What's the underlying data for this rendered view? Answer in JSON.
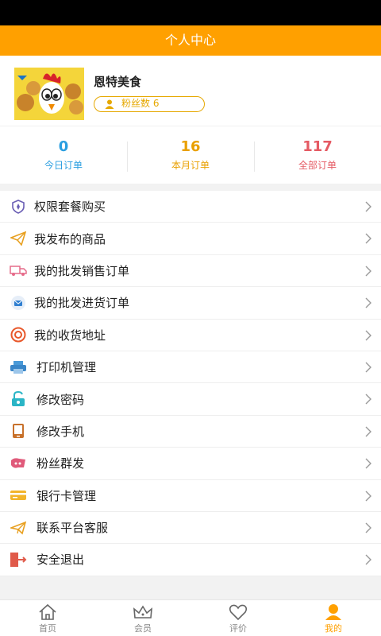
{
  "header": {
    "title": "个人中心"
  },
  "profile": {
    "name": "恩特美食",
    "fans_label": "粉丝数 6"
  },
  "stats": [
    {
      "value": "0",
      "label": "今日订单",
      "color": "#2a9ee0"
    },
    {
      "value": "16",
      "label": "本月订单",
      "color": "#e9a000"
    },
    {
      "value": "117",
      "label": "全部订单",
      "color": "#e55a63"
    }
  ],
  "menu": [
    {
      "label": "权限套餐购买",
      "icon": "shield-icon"
    },
    {
      "label": "我发布的商品",
      "icon": "paper-plane-icon"
    },
    {
      "label": "我的批发销售订单",
      "icon": "truck-icon"
    },
    {
      "label": "我的批发进货订单",
      "icon": "mail-icon"
    },
    {
      "label": "我的收货地址",
      "icon": "target-icon"
    },
    {
      "label": "打印机管理",
      "icon": "printer-icon"
    },
    {
      "label": "修改密码",
      "icon": "lock-icon"
    },
    {
      "label": "修改手机",
      "icon": "phone-icon"
    },
    {
      "label": "粉丝群发",
      "icon": "megaphone-icon"
    },
    {
      "label": "银行卡管理",
      "icon": "card-icon"
    },
    {
      "label": "联系平台客服",
      "icon": "send-icon"
    },
    {
      "label": "安全退出",
      "icon": "exit-icon"
    }
  ],
  "tabs": [
    {
      "label": "首页",
      "icon": "home-icon"
    },
    {
      "label": "会员",
      "icon": "crown-icon"
    },
    {
      "label": "评价",
      "icon": "heart-icon"
    },
    {
      "label": "我的",
      "icon": "user-icon",
      "active": true
    }
  ],
  "colors": {
    "accent": "#ffa000"
  }
}
